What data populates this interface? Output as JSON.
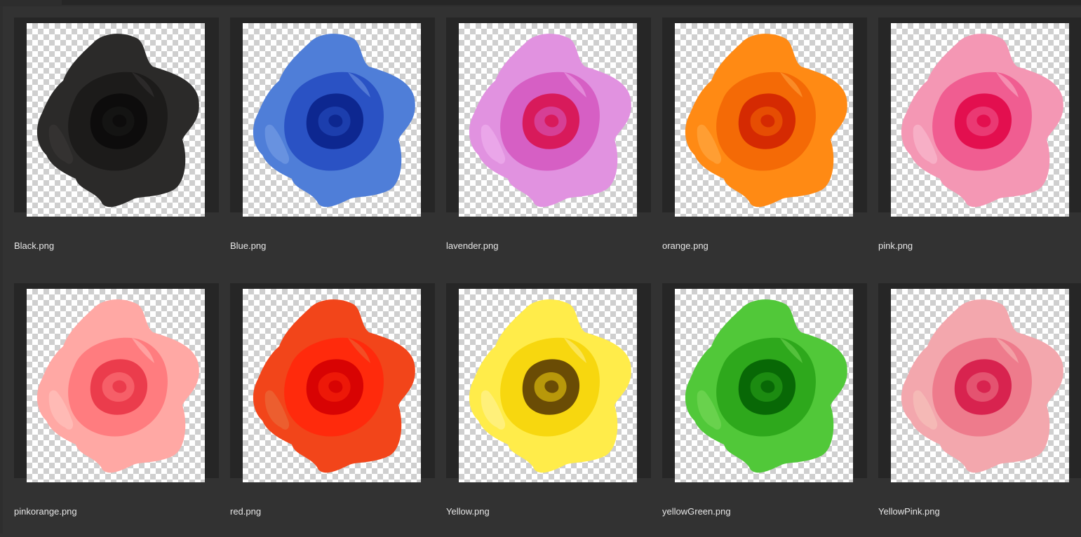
{
  "files": [
    {
      "name": "Black.png",
      "colors": {
        "outer": "#2b2a29",
        "mid": "#1c1b1a",
        "inner": "#0d0c0c",
        "accent": "#3a3837"
      }
    },
    {
      "name": "Blue.png",
      "colors": {
        "outer": "#4f7ed8",
        "mid": "#2a52c4",
        "inner": "#0d2790",
        "accent": "#7aa0e6"
      }
    },
    {
      "name": "lavender.png",
      "colors": {
        "outer": "#e192e0",
        "mid": "#d65fc4",
        "inner": "#d81a5b",
        "accent": "#f0b4ee"
      }
    },
    {
      "name": "orange.png",
      "colors": {
        "outer": "#ff8a14",
        "mid": "#f46a06",
        "inner": "#d52a02",
        "accent": "#ffab47"
      }
    },
    {
      "name": "pink.png",
      "colors": {
        "outer": "#f497b4",
        "mid": "#f05d91",
        "inner": "#e30f4f",
        "accent": "#f9bfd2"
      }
    },
    {
      "name": "pinkorange.png",
      "colors": {
        "outer": "#ffa8a4",
        "mid": "#ff7c7f",
        "inner": "#eb3c4c",
        "accent": "#ffc6c2"
      }
    },
    {
      "name": "red.png",
      "colors": {
        "outer": "#f2451a",
        "mid": "#ff2a0c",
        "inner": "#d80303",
        "accent": "#e8703e"
      }
    },
    {
      "name": "Yellow.png",
      "colors": {
        "outer": "#ffec4a",
        "mid": "#f7d70f",
        "inner": "#6a4c05",
        "accent": "#fff39b"
      }
    },
    {
      "name": "yellowGreen.png",
      "colors": {
        "outer": "#51c839",
        "mid": "#2ea81c",
        "inner": "#086806",
        "accent": "#7ad95c"
      }
    },
    {
      "name": "YellowPink.png",
      "colors": {
        "outer": "#f3a7ad",
        "mid": "#ee7b8c",
        "inner": "#d8234f",
        "accent": "#f7c4bd"
      }
    }
  ]
}
